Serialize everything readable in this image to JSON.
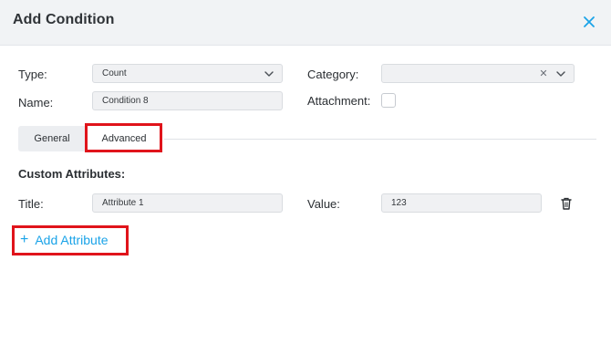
{
  "dialog": {
    "title": "Add Condition"
  },
  "form": {
    "type": {
      "label": "Type:",
      "value": "Count"
    },
    "category": {
      "label": "Category:",
      "value": ""
    },
    "name": {
      "label": "Name:",
      "value": "Condition 8"
    },
    "attachment": {
      "label": "Attachment:",
      "checked": false
    }
  },
  "tabs": [
    {
      "label": "General",
      "active": false
    },
    {
      "label": "Advanced",
      "active": true
    }
  ],
  "custom_attributes": {
    "heading": "Custom Attributes:",
    "items": [
      {
        "title_label": "Title:",
        "title": "Attribute 1",
        "value_label": "Value:",
        "value": "123"
      }
    ],
    "add_label": "Add Attribute"
  },
  "colors": {
    "accent": "#1aa3e8",
    "highlight": "#e0141b",
    "header_bg": "#f1f3f5"
  },
  "icons": {
    "close": "close-icon",
    "dropdown": "chevron-down-icon",
    "clear": "clear-x-icon",
    "delete": "trash-icon",
    "add": "plus-icon"
  }
}
